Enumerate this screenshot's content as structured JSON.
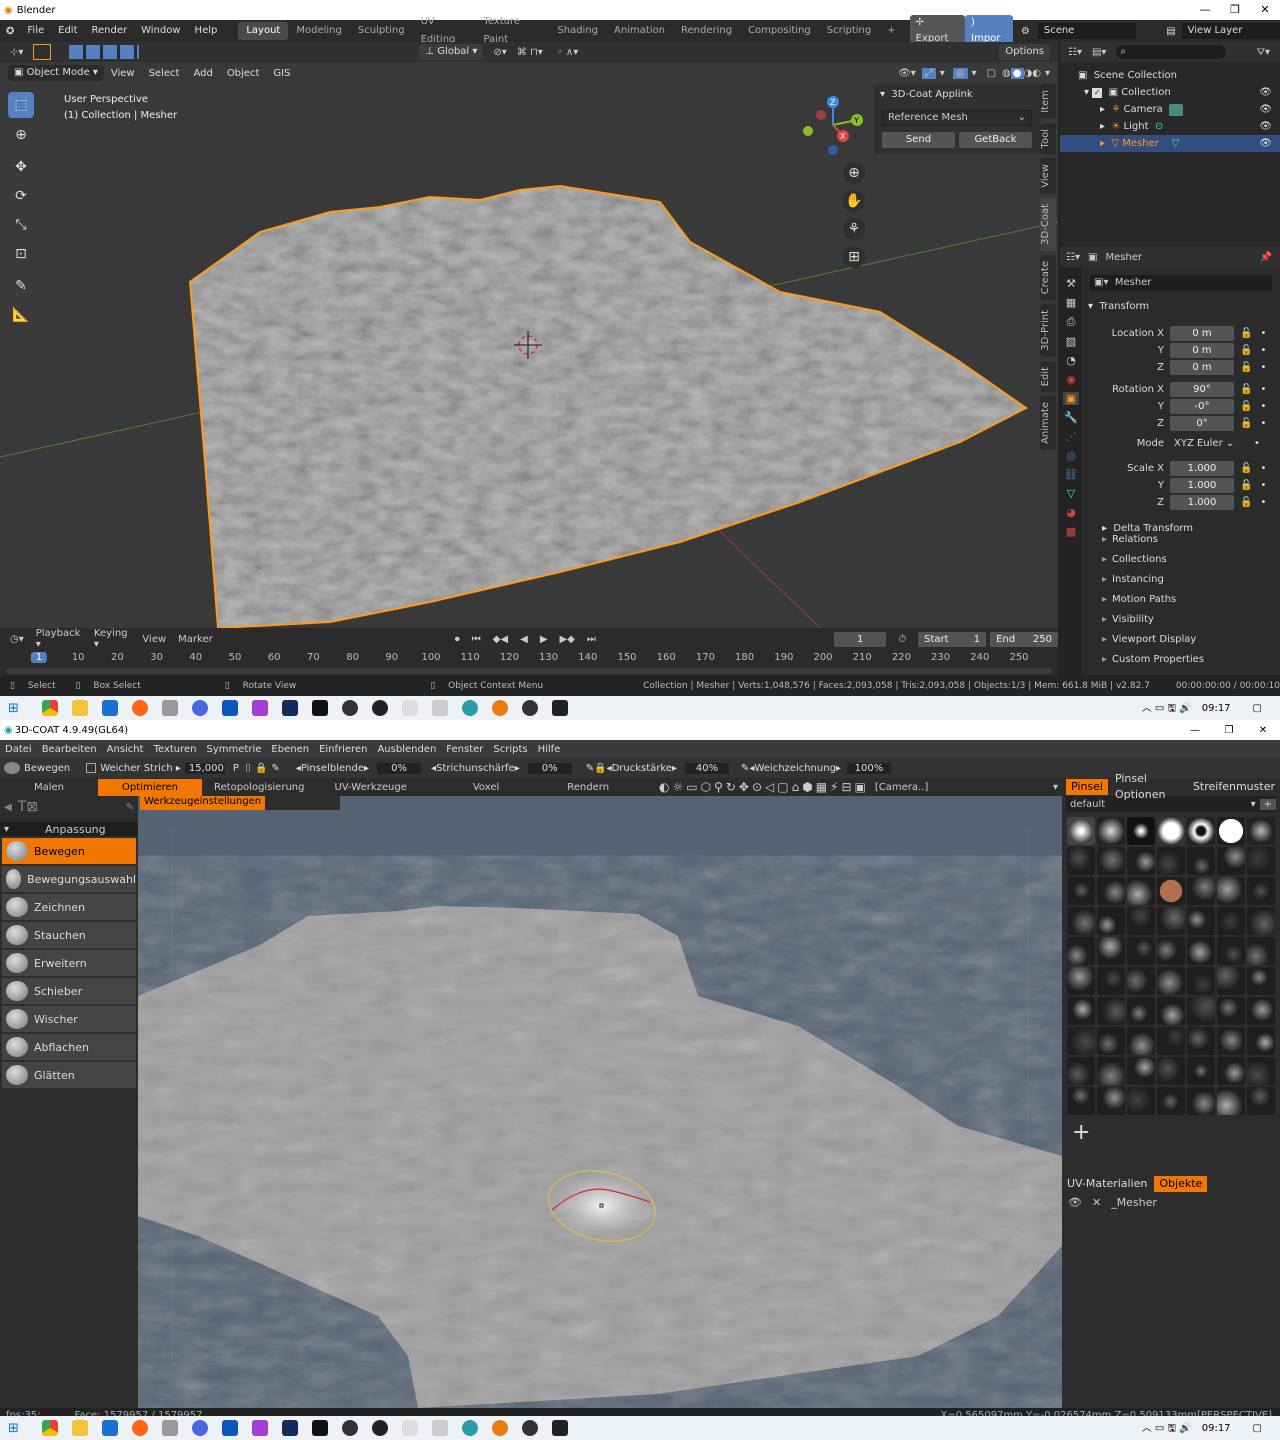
{
  "blender": {
    "title": "Blender",
    "menu": [
      "File",
      "Edit",
      "Render",
      "Window",
      "Help"
    ],
    "workspaces": [
      "Layout",
      "Modeling",
      "Sculpting",
      "UV Editing",
      "Texture Paint",
      "Shading",
      "Animation",
      "Rendering",
      "Compositing",
      "Scripting"
    ],
    "active_workspace": "Layout",
    "export_label": "Export",
    "import_label": "Impor",
    "scene": "Scene",
    "view_layer": "View Layer",
    "transform_orientation": "Global",
    "options": "Options",
    "mode": "Object Mode",
    "header_menu": [
      "View",
      "Select",
      "Add",
      "Object",
      "GIS"
    ],
    "viewport_info": {
      "line1": "User Perspective",
      "line2": "(1) Collection | Mesher"
    },
    "ntabs": [
      "Item",
      "Tool",
      "View",
      "3D-Coat",
      "Create",
      "3D-Print",
      "Edit",
      "Animate"
    ],
    "applink": {
      "title": "3D-Coat Applink",
      "dropdown": "Reference Mesh",
      "send": "Send",
      "getback": "GetBack"
    },
    "outliner": {
      "scene_collection": "Scene Collection",
      "collection": "Collection",
      "camera": "Camera",
      "light": "Light",
      "mesher": "Mesher"
    },
    "props": {
      "object_name": "Mesher",
      "datablock": "Mesher",
      "transform": "Transform",
      "location_x": "Location X",
      "loc_x": "0 m",
      "loc_y": "0 m",
      "loc_z": "0 m",
      "rotation_x": "Rotation X",
      "rot_x": "90°",
      "rot_y": "-0°",
      "rot_z": "0°",
      "mode_label": "Mode",
      "mode": "XYZ Euler",
      "scale_x": "Scale X",
      "sc_x": "1.000",
      "sc_y": "1.000",
      "sc_z": "1.000",
      "y": "Y",
      "z": "Z",
      "delta": "Delta Transform",
      "sections": [
        "Relations",
        "Collections",
        "Instancing",
        "Motion Paths",
        "Visibility",
        "Viewport Display",
        "Custom Properties"
      ]
    },
    "timeline": {
      "menu": [
        "Playback",
        "Keying",
        "View",
        "Marker"
      ],
      "current": "1",
      "start_label": "Start",
      "start": "1",
      "end_label": "End",
      "end": "250",
      "ticks": [
        "1",
        "10",
        "20",
        "30",
        "40",
        "50",
        "60",
        "70",
        "80",
        "90",
        "100",
        "110",
        "120",
        "130",
        "140",
        "150",
        "160",
        "170",
        "180",
        "190",
        "200",
        "210",
        "220",
        "230",
        "240",
        "250"
      ]
    },
    "status": {
      "select": "Select",
      "box_select": "Box Select",
      "rotate": "Rotate View",
      "context": "Object Context Menu",
      "stats": "Collection | Mesher | Verts:1,048,576 | Faces:2,093,058 | Tris:2,093,058 | Objects:1/3 | Mem: 661.8 MiB | v2.82.7",
      "time": "00:00:00:00 / 00:00:10"
    }
  },
  "taskbar": {
    "time": "09:17"
  },
  "coat": {
    "title": "3D-COAT 4.9.49(GL64)",
    "menu": [
      "Datei",
      "Bearbeiten",
      "Ansicht",
      "Texturen",
      "Symmetrie",
      "Ebenen",
      "Einfrieren",
      "Ausblenden",
      "Fenster",
      "Scripts",
      "Hilfe"
    ],
    "toolbar": {
      "tool": "Bewegen",
      "soft_stroke": "Weicher Strich",
      "value": "15,000",
      "p": "P",
      "brush_blend": "Pinselblende",
      "brush_blend_val": "0%",
      "stroke_sharp": "Strichunschärfe",
      "stroke_sharp_val": "0%",
      "pressure": "Druckstärke",
      "pressure_val": "40%",
      "smoothing": "Weichzeichnung",
      "smoothing_val": "100%"
    },
    "rooms": [
      "Malen",
      "Optimieren",
      "Retopologisierung",
      "UV-Werkzeuge",
      "Voxel",
      "Rendern"
    ],
    "active_room": "Optimieren",
    "camera": "[Camera..]",
    "tool_settings": "Werkzeugeinstellungen",
    "group": "Anpassung",
    "tools": [
      "Bewegen",
      "Bewegungsauswahl",
      "Zeichnen",
      "Stauchen",
      "Erweitern",
      "Schieber",
      "Wischer",
      "Abflachen",
      "Glätten"
    ],
    "active_tool": "Bewegen",
    "right_tabs": [
      "Pinsel",
      "Pinsel Optionen",
      "Streifenmuster"
    ],
    "preset": "default",
    "bottom_tabs": [
      "UV-Materialien",
      "Objekte"
    ],
    "object": "_Mesher",
    "status": {
      "fps": "fps:35;",
      "face": "Face: 1579957 / 1579957",
      "coords": "X=0,565097mm  Y=-0,026574mm  Z=0,509133mm[PERSPECTIVE]"
    }
  },
  "colors": {
    "blender_accent": "#5680c2",
    "blender_select": "#ff9a1f",
    "coat_accent": "#f07800"
  }
}
